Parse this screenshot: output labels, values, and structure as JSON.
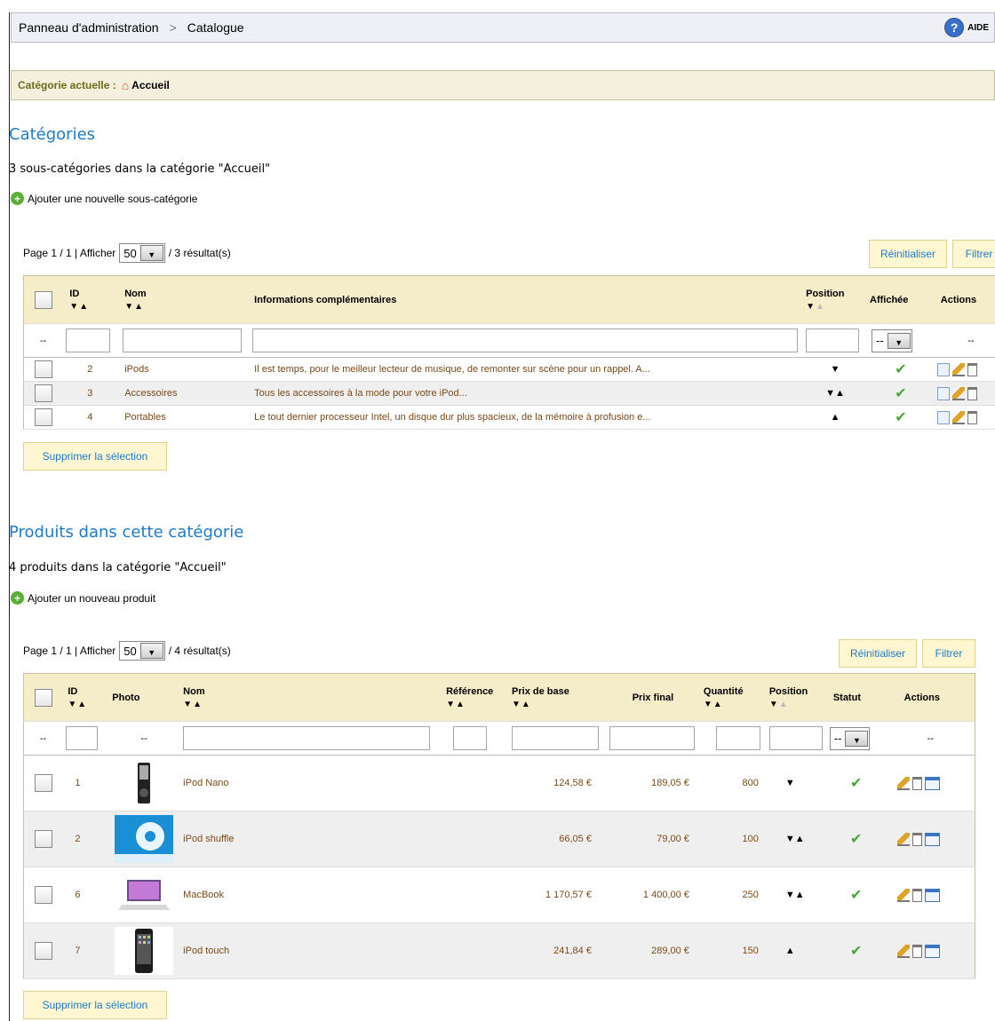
{
  "breadcrumb": {
    "root": "Panneau d'administration",
    "separator": ">",
    "current": "Catalogue"
  },
  "help": {
    "label": "AIDE",
    "icon": "help-icon"
  },
  "current_category": {
    "label": "Catégorie actuelle :",
    "value": "Accueil",
    "icon": "home-icon"
  },
  "categories": {
    "title": "Catégories",
    "count_text": "3 sous-catégories dans la catégorie \"Accueil\"",
    "add_label": "Ajouter une nouvelle sous-catégorie",
    "pager": {
      "page_text": "Page 1 / 1 | Afficher",
      "per_page": "50",
      "results": "/ 3 résultat(s)"
    },
    "reset_label": "Réinitialiser",
    "filter_label": "Filtrer",
    "headers": {
      "id": "ID",
      "name": "Nom",
      "info": "Informations complémentaires",
      "position": "Position",
      "displayed": "Affichée",
      "actions": "Actions"
    },
    "sort_arrows": "▼▲",
    "filter_dash": "--",
    "filter_select": "--",
    "rows": [
      {
        "id": "2",
        "name": "iPods",
        "info": "Il est temps, pour le meilleur lecteur de musique, de remonter sur scène pour un rappel. A...",
        "position": "▼"
      },
      {
        "id": "3",
        "name": "Accessoires",
        "info": "Tous les accessoires à la mode pour votre iPod...",
        "position": "▼▲"
      },
      {
        "id": "4",
        "name": "Portables",
        "info": "Le tout dernier processeur Intel, un disque dur plus spacieux, de la mémoire à profusion e...",
        "position": "▲"
      }
    ],
    "delete_label": "Supprimer la sélection"
  },
  "products": {
    "title": "Produits dans cette catégorie",
    "count_text": "4 produits dans la catégorie \"Accueil\"",
    "add_label": "Ajouter un nouveau produit",
    "pager": {
      "page_text": "Page 1 / 1 | Afficher",
      "per_page": "50",
      "results": "/ 4 résultat(s)"
    },
    "reset_label": "Réinitialiser",
    "filter_label": "Filtrer",
    "headers": {
      "id": "ID",
      "photo": "Photo",
      "name": "Nom",
      "reference": "Référence",
      "base_price": "Prix de base",
      "final_price": "Prix final",
      "quantity": "Quantité",
      "position": "Position",
      "status": "Statut",
      "actions": "Actions"
    },
    "sort_arrows": "▼▲",
    "filter_dash": "--",
    "filter_select": "--",
    "rows": [
      {
        "id": "1",
        "name": "iPod Nano",
        "base_price": "124,58 €",
        "final_price": "189,05 €",
        "quantity": "800",
        "position": "▼",
        "photo": "ipod-nano"
      },
      {
        "id": "2",
        "name": "iPod shuffle",
        "base_price": "66,05 €",
        "final_price": "79,00 €",
        "quantity": "100",
        "position": "▼▲",
        "photo": "ipod-shuffle"
      },
      {
        "id": "6",
        "name": "MacBook",
        "base_price": "1 170,57 €",
        "final_price": "1 400,00 €",
        "quantity": "250",
        "position": "▼▲",
        "photo": "macbook"
      },
      {
        "id": "7",
        "name": "iPod touch",
        "base_price": "241,84 €",
        "final_price": "289,00 €",
        "quantity": "150",
        "position": "▲",
        "photo": "ipod-touch"
      }
    ],
    "delete_label": "Supprimer la sélection"
  },
  "colors": {
    "link": "#1e7bc9",
    "header_bg": "#f5ecc9",
    "button_bg": "#fff6d2",
    "ok": "#4aa838"
  }
}
